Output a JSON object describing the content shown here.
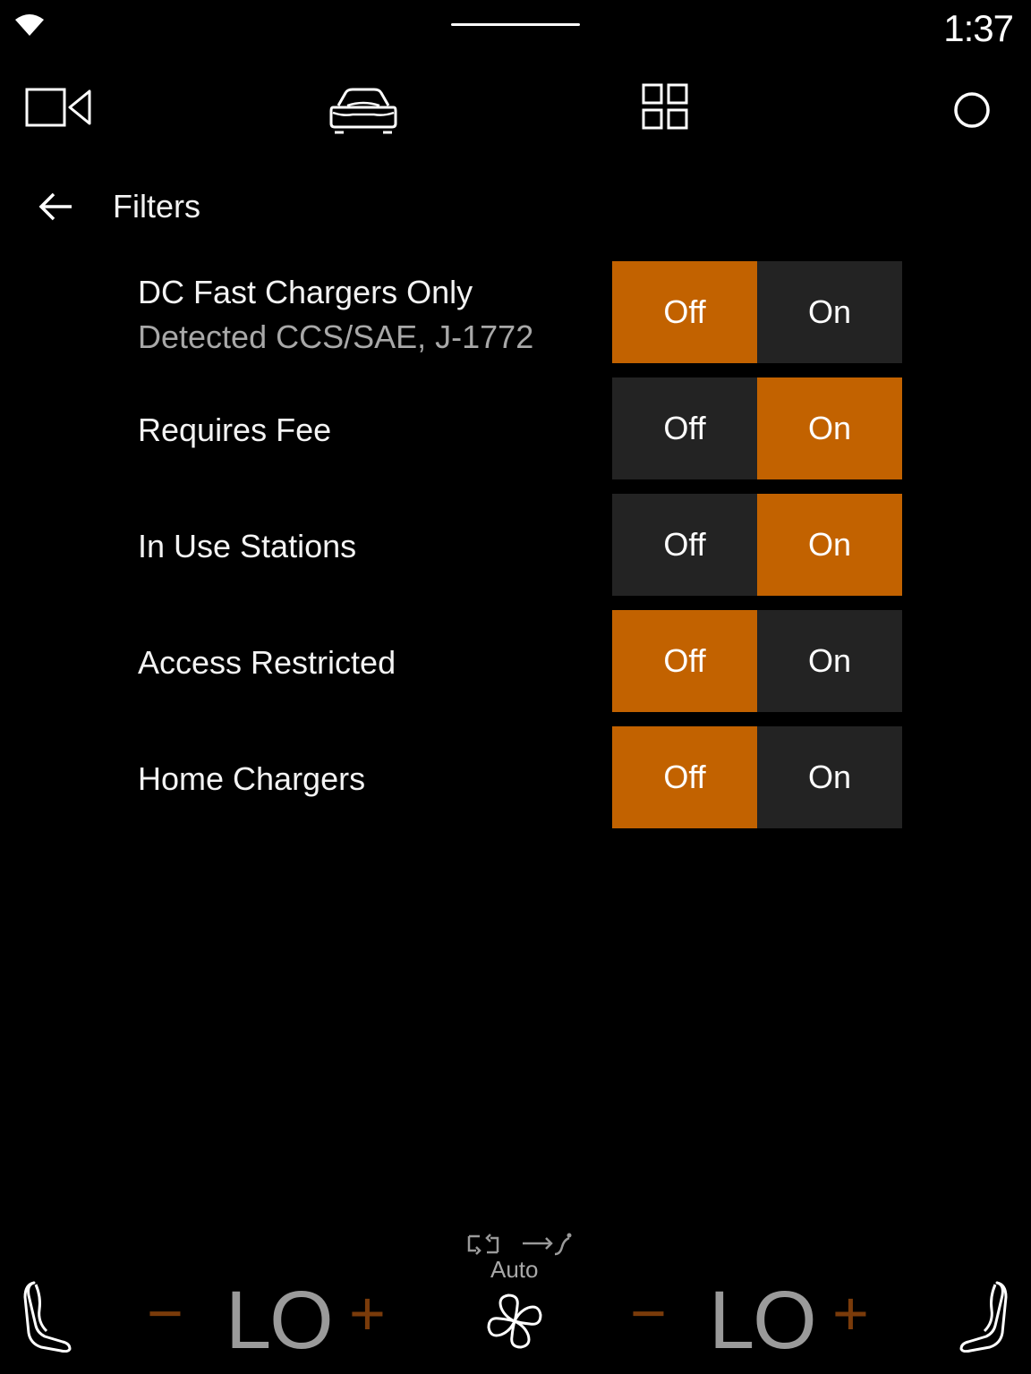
{
  "status": {
    "time": "1:37"
  },
  "nav": {
    "items": [
      {
        "icon": "camera-icon"
      },
      {
        "icon": "car-icon"
      },
      {
        "icon": "apps-grid-icon"
      },
      {
        "icon": "home-circle-icon"
      }
    ]
  },
  "header": {
    "title": "Filters",
    "back_icon": "back-arrow-icon"
  },
  "filters": [
    {
      "label": "DC Fast Chargers Only",
      "sublabel": "Detected CCS/SAE, J-1772",
      "off": "Off",
      "on": "On",
      "value": "Off"
    },
    {
      "label": "Requires Fee",
      "off": "Off",
      "on": "On",
      "value": "On"
    },
    {
      "label": "In Use Stations",
      "off": "Off",
      "on": "On",
      "value": "On"
    },
    {
      "label": "Access Restricted",
      "off": "Off",
      "on": "On",
      "value": "Off"
    },
    {
      "label": "Home Chargers",
      "off": "Off",
      "on": "On",
      "value": "Off"
    }
  ],
  "climate": {
    "left_temp": "LO",
    "right_temp": "LO",
    "minus": "−",
    "plus": "+",
    "mode": "Auto"
  },
  "colors": {
    "accent": "#c26200",
    "segment_inactive": "#232323",
    "background": "#000000",
    "temp_control": "#7a3b0a"
  }
}
